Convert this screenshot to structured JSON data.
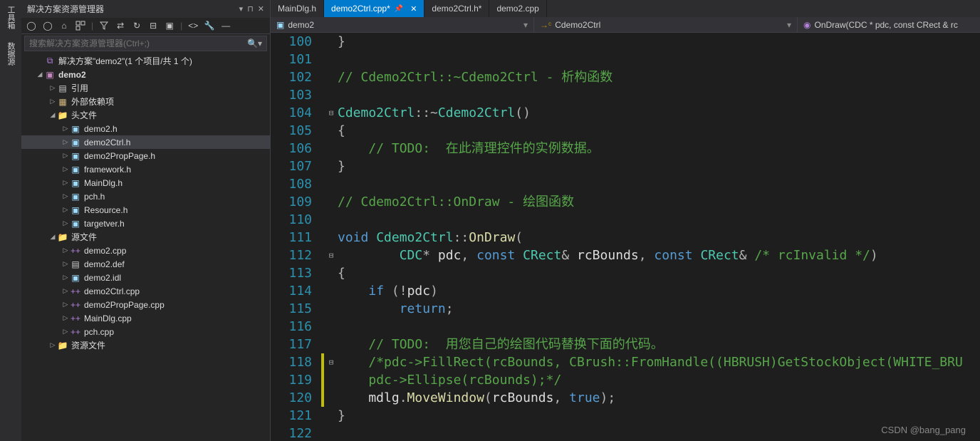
{
  "verticalTabs": [
    "工具箱",
    "数据源"
  ],
  "panel": {
    "title": "解决方案资源管理器",
    "headerIcons": [
      "▾",
      "⊓",
      "✕"
    ],
    "searchPlaceholder": "搜索解决方案资源管理器(Ctrl+;)"
  },
  "tree": {
    "solution": "解决方案\"demo2\"(1 个项目/共 1 个)",
    "project": "demo2",
    "refs": "引用",
    "ext": "外部依赖项",
    "headers": "头文件",
    "sources": "源文件",
    "resources": "资源文件",
    "hfiles": [
      "demo2.h",
      "demo2Ctrl.h",
      "demo2PropPage.h",
      "framework.h",
      "MainDlg.h",
      "pch.h",
      "Resource.h",
      "targetver.h"
    ],
    "cfiles": [
      "demo2.cpp",
      "demo2.def",
      "demo2.idl",
      "demo2Ctrl.cpp",
      "demo2PropPage.cpp",
      "MainDlg.cpp",
      "pch.cpp"
    ]
  },
  "tabs": [
    {
      "label": "MainDlg.h",
      "active": false,
      "dirty": false
    },
    {
      "label": "demo2Ctrl.cpp*",
      "active": true,
      "dirty": true,
      "pinned": true
    },
    {
      "label": "demo2Ctrl.h*",
      "active": false,
      "dirty": true
    },
    {
      "label": "demo2.cpp",
      "active": false,
      "dirty": false
    }
  ],
  "nav": {
    "scope": "demo2",
    "class": "Cdemo2Ctrl",
    "func": "OnDraw(CDC * pdc, const CRect & rc"
  },
  "code": {
    "start": 100,
    "lines": [
      {
        "n": 100,
        "html": "<span class='c-op'>}</span>"
      },
      {
        "n": 101,
        "html": ""
      },
      {
        "n": 102,
        "html": "<span class='c-comment'>// Cdemo2Ctrl::~Cdemo2Ctrl - 析构函数</span>"
      },
      {
        "n": 103,
        "html": ""
      },
      {
        "n": 104,
        "fold": "⊟",
        "html": "<span class='c-type'>Cdemo2Ctrl</span><span class='c-op'>::~</span><span class='c-type'>Cdemo2Ctrl</span><span class='c-op'>()</span>"
      },
      {
        "n": 105,
        "html": "<span class='c-op'>{</span>"
      },
      {
        "n": 106,
        "html": "    <span class='c-comment'>// TODO:  在此清理控件的实例数据。</span>"
      },
      {
        "n": 107,
        "html": "<span class='c-op'>}</span>"
      },
      {
        "n": 108,
        "html": ""
      },
      {
        "n": 109,
        "html": "<span class='c-comment'>// Cdemo2Ctrl::OnDraw - 绘图函数</span>"
      },
      {
        "n": 110,
        "html": ""
      },
      {
        "n": 111,
        "html": "<span class='c-kw'>void</span> <span class='c-type'>Cdemo2Ctrl</span><span class='c-op'>::</span><span class='c-func'>OnDraw</span><span class='c-op'>(</span>"
      },
      {
        "n": 112,
        "fold": "⊟",
        "html": "        <span class='c-type'>CDC</span><span class='c-op'>*</span> pdc<span class='c-op'>,</span> <span class='c-kw'>const</span> <span class='c-type'>CRect</span><span class='c-op'>&amp;</span> rcBounds<span class='c-op'>,</span> <span class='c-kw'>const</span> <span class='c-type'>CRect</span><span class='c-op'>&amp;</span> <span class='c-comment'>/* rcInvalid */</span><span class='c-op'>)</span>"
      },
      {
        "n": 113,
        "html": "<span class='c-op'>{</span>"
      },
      {
        "n": 114,
        "html": "    <span class='c-kw'>if</span> <span class='c-op'>(!</span>pdc<span class='c-op'>)</span>"
      },
      {
        "n": 115,
        "html": "        <span class='c-kw'>return</span><span class='c-op'>;</span>"
      },
      {
        "n": 116,
        "html": ""
      },
      {
        "n": 117,
        "html": "    <span class='c-comment'>// TODO:  用您自己的绘图代码替换下面的代码。</span>"
      },
      {
        "n": 118,
        "mod": true,
        "fold": "⊟",
        "html": "    <span class='c-comment'>/*pdc-&gt;FillRect(rcBounds, CBrush::FromHandle((HBRUSH)GetStockObject(WHITE_BRU</span>"
      },
      {
        "n": 119,
        "mod": true,
        "html": "    <span class='c-comment'>pdc-&gt;Ellipse(rcBounds);*/</span>"
      },
      {
        "n": 120,
        "mod": true,
        "html": "    mdlg<span class='c-op'>.</span><span class='c-func'>MoveWindow</span><span class='c-op'>(</span>rcBounds<span class='c-op'>,</span> <span class='c-kw'>true</span><span class='c-op'>);</span>"
      },
      {
        "n": 121,
        "html": "<span class='c-op'>}</span>"
      },
      {
        "n": 122,
        "html": ""
      }
    ]
  },
  "watermark": "CSDN @bang_pang"
}
